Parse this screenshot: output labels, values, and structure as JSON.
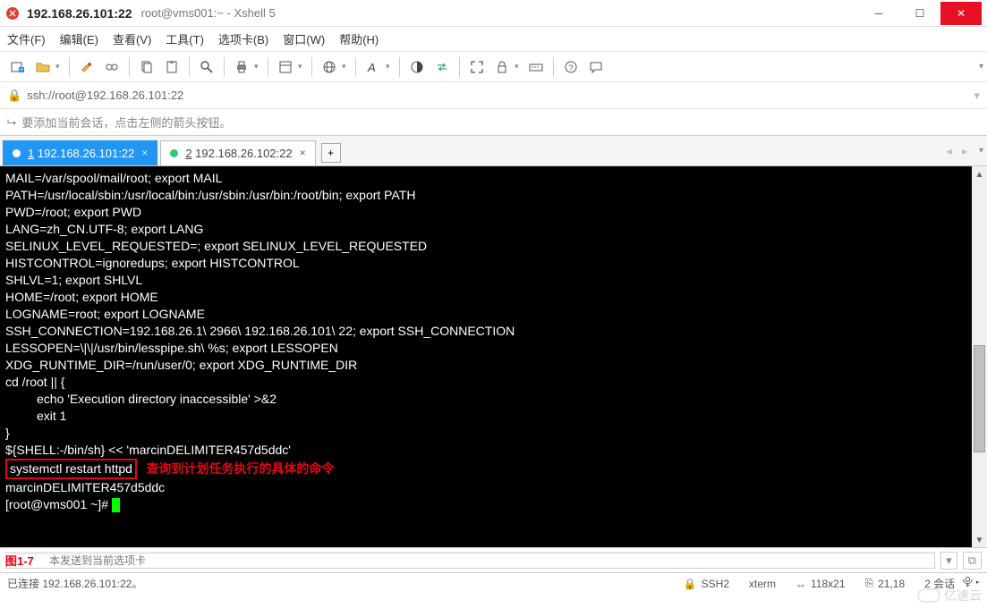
{
  "window": {
    "host": "192.168.26.101:22",
    "title": "root@vms001:~ - Xshell 5"
  },
  "menu": {
    "file": "文件(F)",
    "edit": "编辑(E)",
    "view": "查看(V)",
    "tools": "工具(T)",
    "tabs": "选项卡(B)",
    "window": "窗口(W)",
    "help": "帮助(H)"
  },
  "address": {
    "url": "ssh://root@192.168.26.101:22"
  },
  "hint": {
    "text": "要添加当前会话，点击左侧的箭头按钮。"
  },
  "tabs": {
    "items": [
      {
        "index": "1",
        "label": "192.168.26.101:22",
        "active": true
      },
      {
        "index": "2",
        "label": "192.168.26.102:22",
        "active": false
      }
    ],
    "add": "+"
  },
  "terminal": {
    "lines": [
      "MAIL=/var/spool/mail/root; export MAIL",
      "PATH=/usr/local/sbin:/usr/local/bin:/usr/sbin:/usr/bin:/root/bin; export PATH",
      "PWD=/root; export PWD",
      "LANG=zh_CN.UTF-8; export LANG",
      "SELINUX_LEVEL_REQUESTED=; export SELINUX_LEVEL_REQUESTED",
      "HISTCONTROL=ignoredups; export HISTCONTROL",
      "SHLVL=1; export SHLVL",
      "HOME=/root; export HOME",
      "LOGNAME=root; export LOGNAME",
      "SSH_CONNECTION=192.168.26.1\\ 2966\\ 192.168.26.101\\ 22; export SSH_CONNECTION",
      "LESSOPEN=\\|\\|/usr/bin/lesspipe.sh\\ %s; export LESSOPEN",
      "XDG_RUNTIME_DIR=/run/user/0; export XDG_RUNTIME_DIR",
      "cd /root || {",
      "         echo 'Execution directory inaccessible' >&2",
      "         exit 1",
      "}",
      "${SHELL:-/bin/sh} << 'marcinDELIMITER457d5ddc'"
    ],
    "highlight_cmd": "systemctl restart httpd",
    "highlight_note": "查询到计划任务执行的具体的命令",
    "tail": [
      "",
      "marcinDELIMITER457d5ddc",
      "[root@vms001 ~]# "
    ]
  },
  "sendbar": {
    "figlabel": "图1-7",
    "placeholder": "本发送到当前选项卡"
  },
  "status": {
    "connected": "已连接 192.168.26.101:22。",
    "proto": "SSH2",
    "term": "xterm",
    "size": "118x21",
    "cursor": "21,18",
    "sessions": "2 会话"
  },
  "watermark": "亿速云"
}
